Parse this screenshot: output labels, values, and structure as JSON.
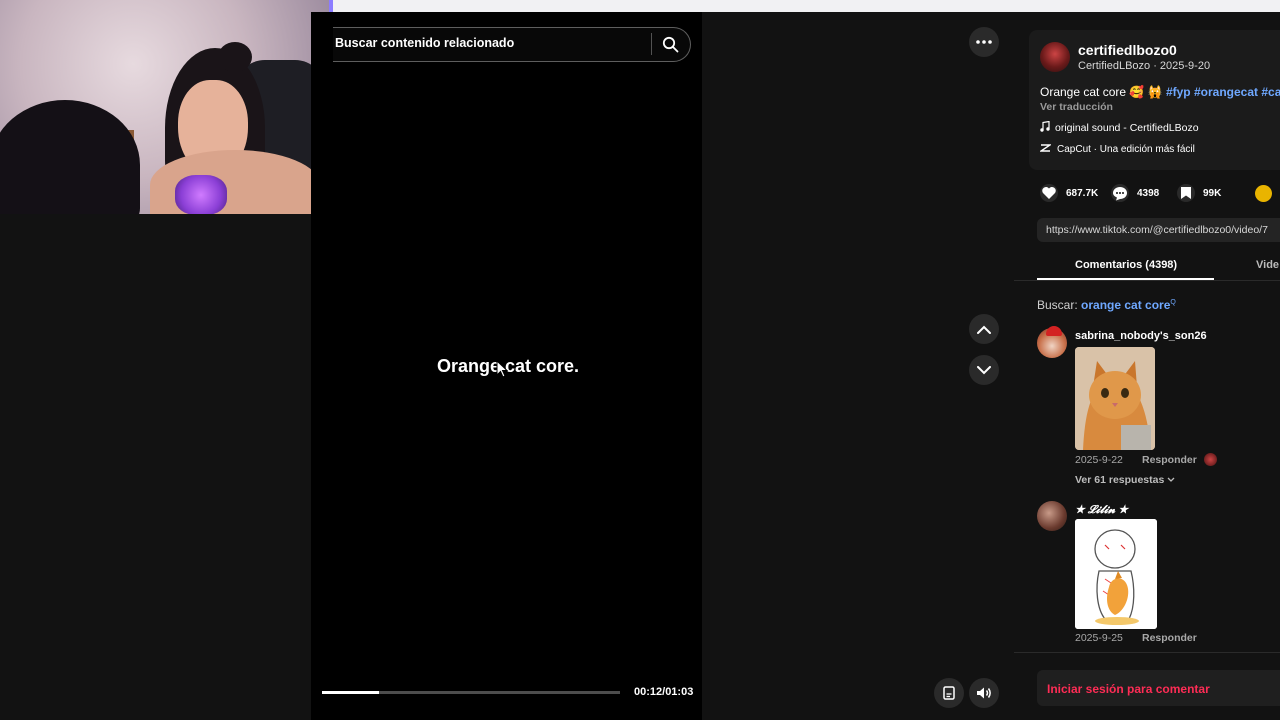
{
  "search": {
    "placeholder": "Buscar contenido relacionado"
  },
  "video": {
    "caption": "Orange cat core.",
    "time": "00:12/01:03",
    "progress": 0.19
  },
  "author": {
    "username": "certifiedlbozo0",
    "handle_line": "CertifiedLBozo · 2025-9-20",
    "description_text": "Orange cat core 🥰 🙀 ",
    "hashtags": [
      "#fyp",
      "#orangecat",
      "#ca"
    ],
    "translate": "Ver traducción",
    "sound": "original sound - CertifiedLBozo",
    "capcut": "CapCut · Una edición más fácil"
  },
  "stats": {
    "likes": "687.7K",
    "comments": "4398",
    "saves": "99K"
  },
  "url": "https://www.tiktok.com/@certifiedlbozo0/video/7",
  "tabs": {
    "comments": "Comentarios (4398)",
    "videos": "Vide"
  },
  "comment_search": {
    "label": "Buscar: ",
    "query": "orange cat core",
    "sup": "Q"
  },
  "comments": [
    {
      "user": "sabrina_nobody's_son26",
      "date": "2025-9-22",
      "reply": "Responder",
      "more": "Ver 61 respuestas"
    },
    {
      "user": "★ 𝓛𝓲𝓵𝓲𝓷 ★",
      "date": "2025-9-25",
      "reply": "Responder"
    }
  ],
  "login": "Iniciar sesión para comentar",
  "icons": {
    "search": "search-icon",
    "more": "ellipsis-icon",
    "up": "chevron-up-icon",
    "down": "chevron-down-icon",
    "volume": "volume-icon",
    "caption": "caption-icon",
    "heart": "heart-icon",
    "comment": "comment-icon",
    "bookmark": "bookmark-icon",
    "music": "music-note-icon",
    "capcut": "capcut-icon"
  },
  "colors": {
    "accent_link": "#6fa8ff",
    "login_red": "#fe2c55",
    "coin": "#e9b400"
  }
}
